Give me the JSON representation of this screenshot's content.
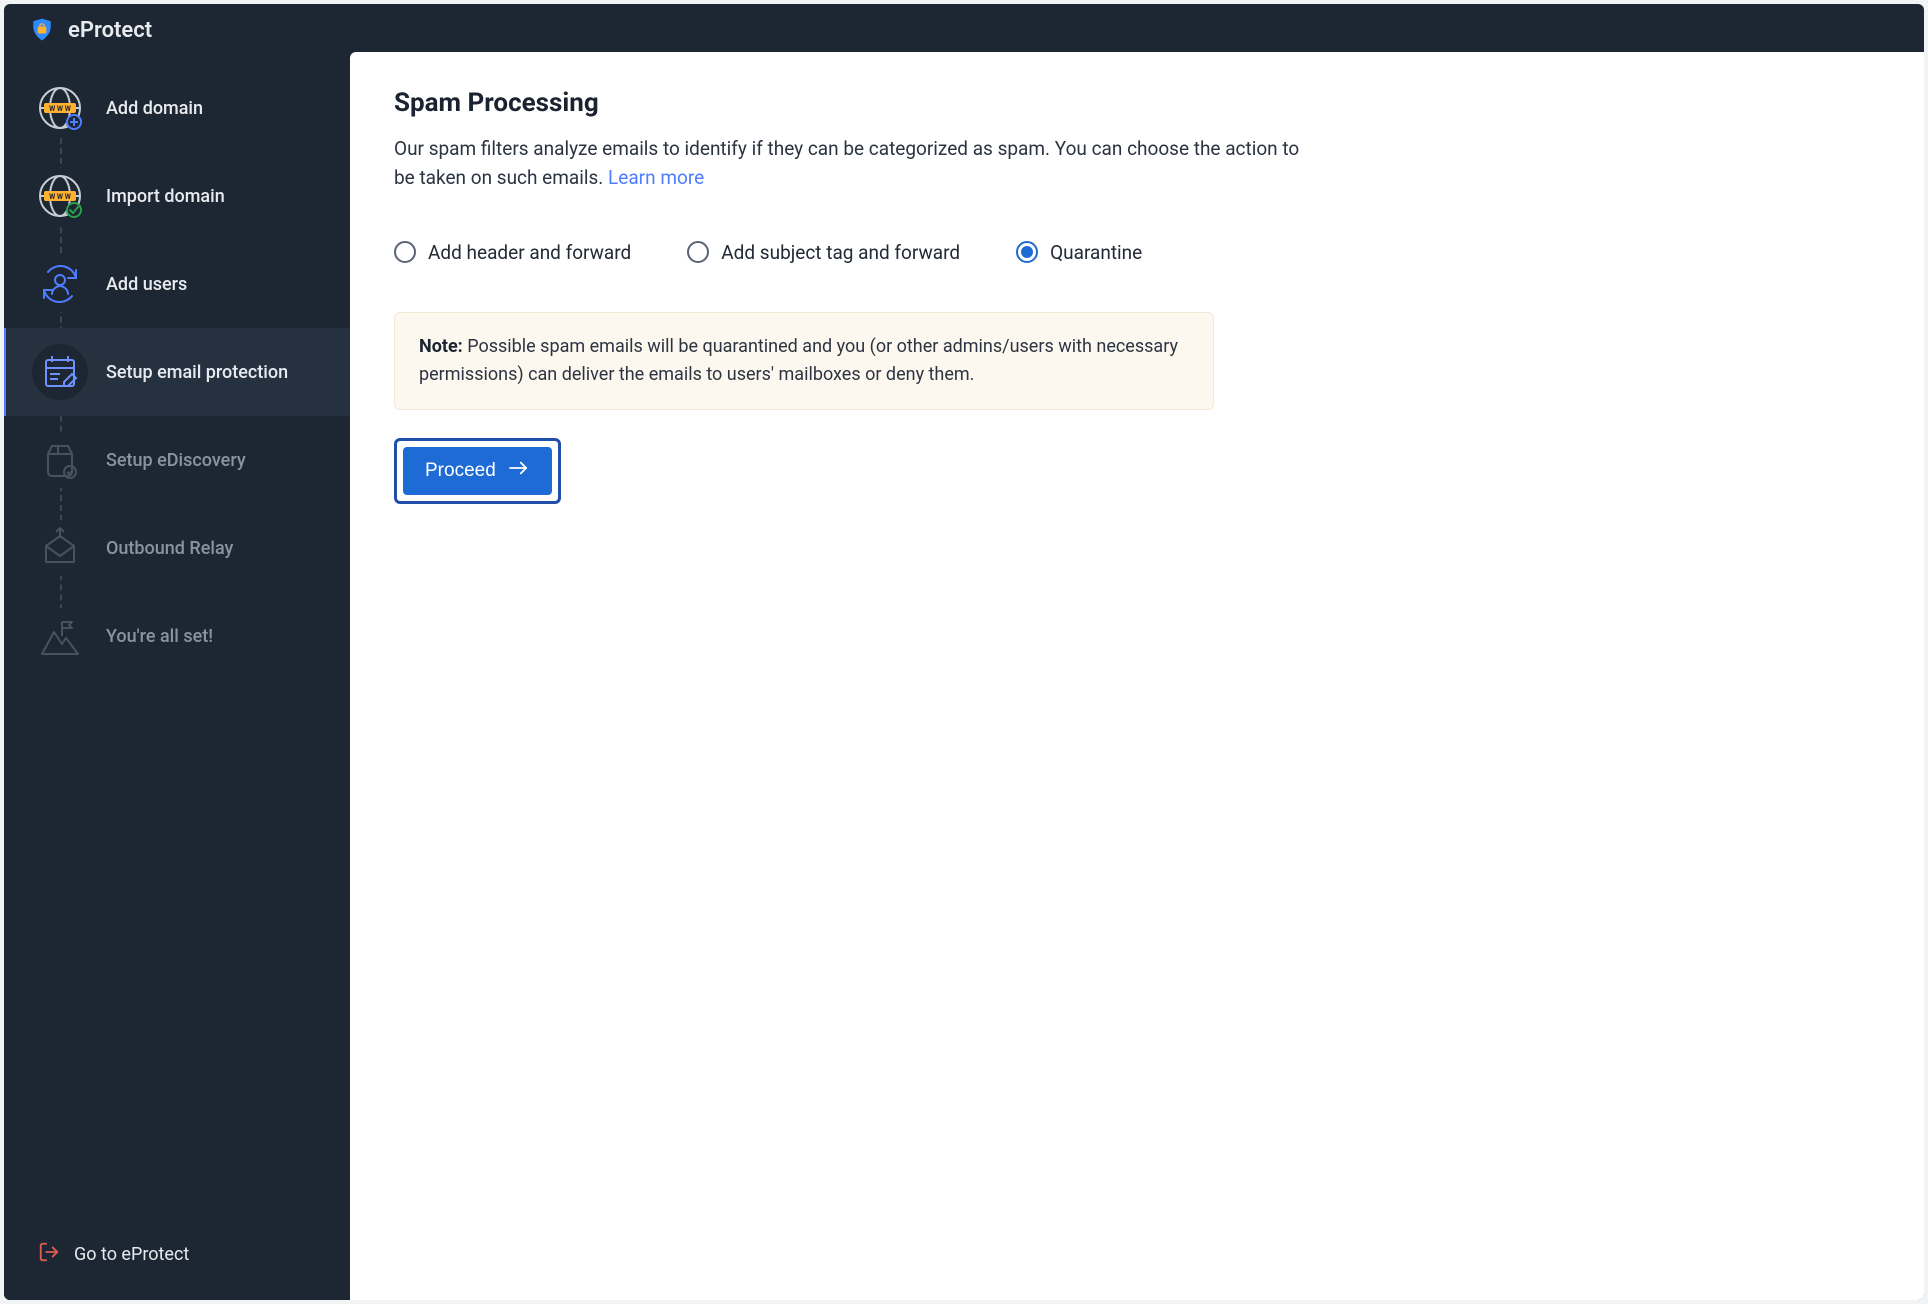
{
  "app": {
    "title": "eProtect"
  },
  "sidebar": {
    "steps": [
      {
        "label": "Add domain",
        "active": false,
        "dim": false
      },
      {
        "label": "Import domain",
        "active": false,
        "dim": false
      },
      {
        "label": "Add users",
        "active": false,
        "dim": false
      },
      {
        "label": "Setup email protection",
        "active": true,
        "dim": false
      },
      {
        "label": "Setup eDiscovery",
        "active": false,
        "dim": true
      },
      {
        "label": "Outbound Relay",
        "active": false,
        "dim": true
      },
      {
        "label": "You're all set!",
        "active": false,
        "dim": true
      }
    ],
    "goto_label": "Go to eProtect"
  },
  "main": {
    "title": "Spam Processing",
    "description": "Our spam filters analyze emails to identify if they can be categorized as spam. You can choose the action to be taken on such emails. ",
    "learn_more": "Learn more",
    "options": [
      {
        "label": "Add header and forward",
        "selected": false
      },
      {
        "label": "Add subject tag and forward",
        "selected": false
      },
      {
        "label": "Quarantine",
        "selected": true
      }
    ],
    "note_label": "Note:",
    "note_body": "Possible spam emails will be quarantined and you (or other admins/users with necessary permissions) can deliver the emails to users' mailboxes or deny them.",
    "proceed_label": "Proceed"
  },
  "colors": {
    "accent": "#1f6bd6",
    "sidebar_bg": "#1d2733"
  }
}
